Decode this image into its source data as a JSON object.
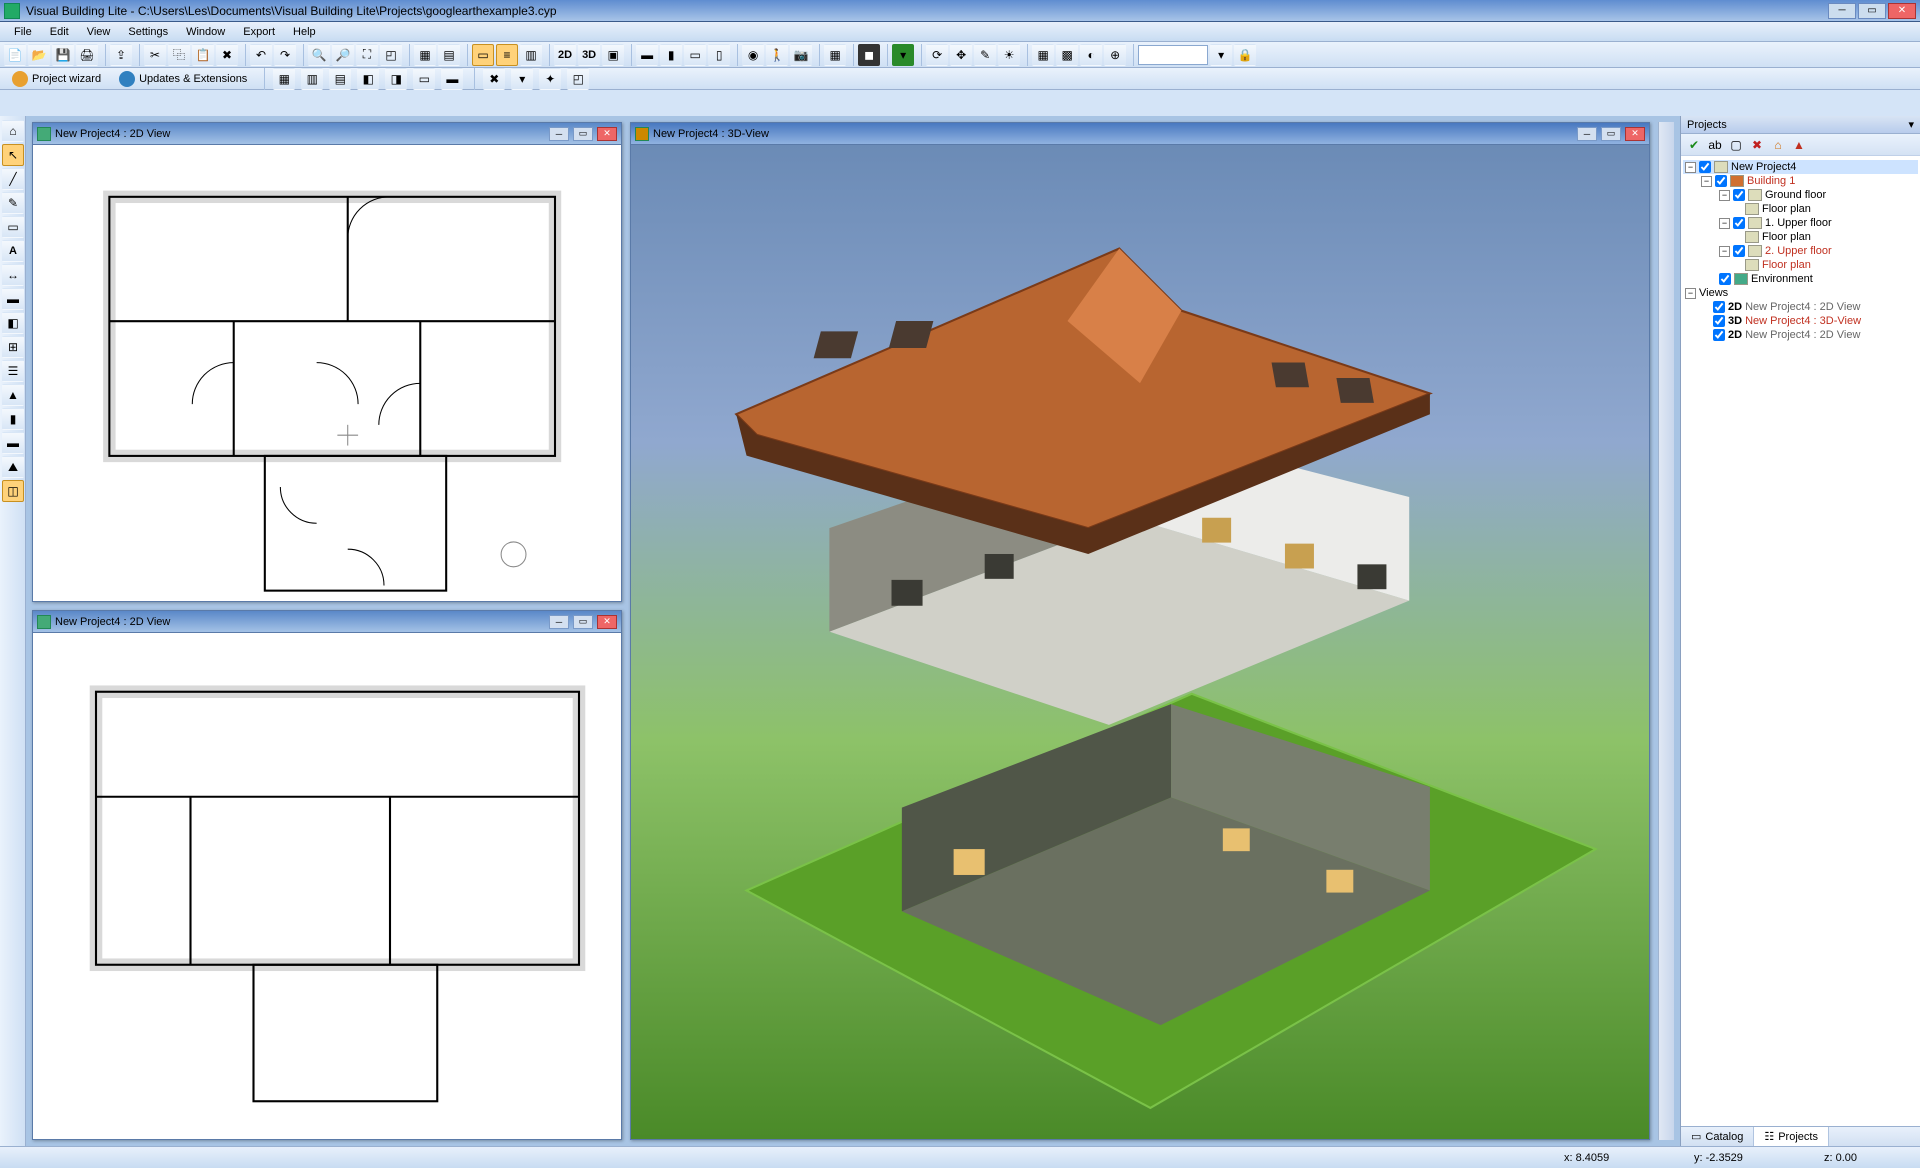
{
  "app": {
    "title": "Visual Building Lite - C:\\Users\\Les\\Documents\\Visual Building Lite\\Projects\\googlearthexample3.cyp"
  },
  "menu": [
    "File",
    "Edit",
    "View",
    "Settings",
    "Window",
    "Export",
    "Help"
  ],
  "toolbar2": {
    "project_wizard": "Project wizard",
    "updates": "Updates & Extensions"
  },
  "windows": {
    "view2d_a": "New Project4 : 2D View",
    "view2d_b": "New Project4 : 2D View",
    "view3d": "New Project4 : 3D-View"
  },
  "projects_panel": {
    "title": "Projects",
    "tree": {
      "root": "New Project4",
      "building": "Building 1",
      "ground_floor": "Ground floor",
      "floor_plan_1": "Floor plan",
      "upper_1": "1. Upper floor",
      "floor_plan_2": "Floor plan",
      "upper_2": "2. Upper floor",
      "floor_plan_3": "Floor plan",
      "environment": "Environment",
      "views": "Views",
      "v1_tag": "2D",
      "v1_label": "New Project4 : 2D View",
      "v2_tag": "3D",
      "v2_label": "New Project4 : 3D-View",
      "v3_tag": "2D",
      "v3_label": "New Project4 : 2D View"
    },
    "tabs": {
      "catalog": "Catalog",
      "projects": "Projects"
    }
  },
  "status": {
    "x": "x: 8.4059",
    "y": "y: -2.3529",
    "z": "z: 0.00"
  }
}
